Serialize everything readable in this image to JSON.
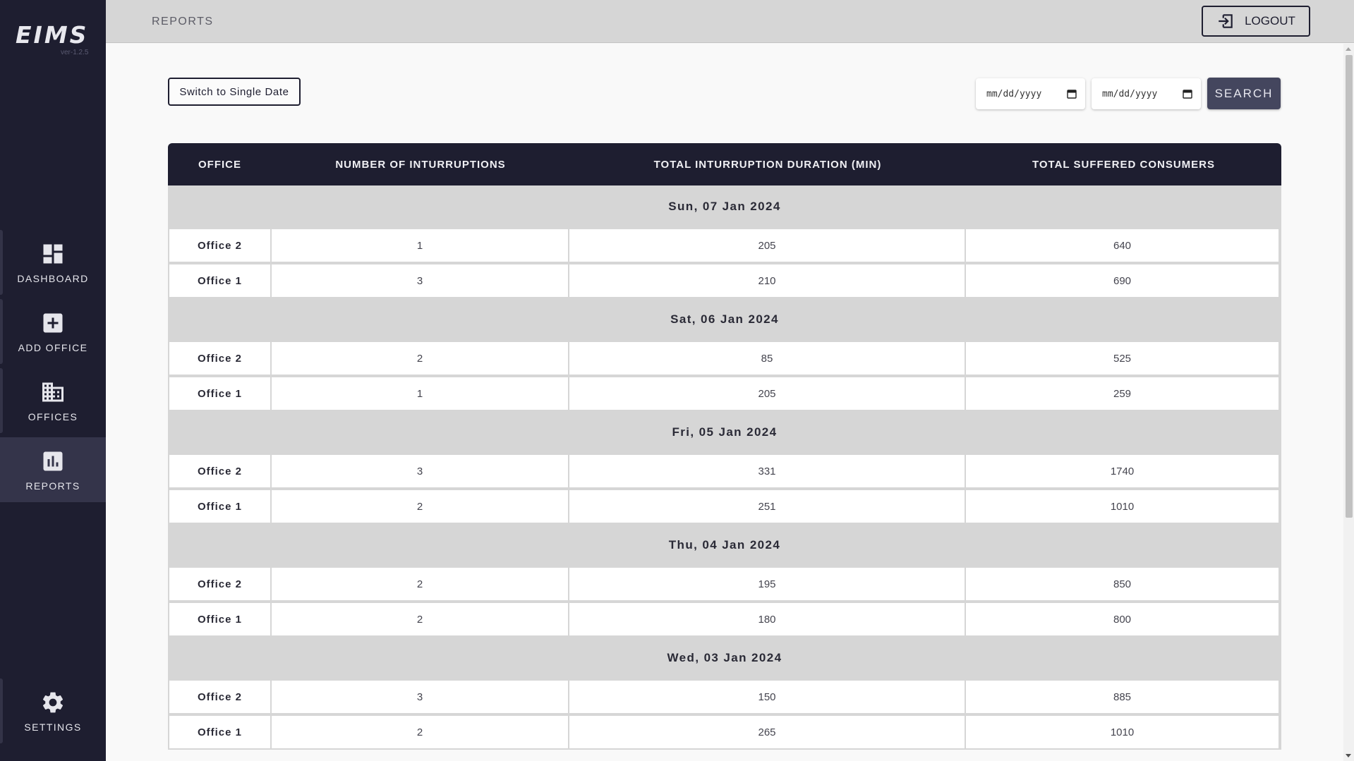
{
  "app": {
    "name": "EIMS",
    "version": "ver-1.2.5"
  },
  "sidebar": {
    "items": [
      {
        "label": "DASHBOARD",
        "icon": "dashboard-icon"
      },
      {
        "label": "ADD OFFICE",
        "icon": "add-box-icon"
      },
      {
        "label": "OFFICES",
        "icon": "building-icon"
      },
      {
        "label": "REPORTS",
        "icon": "bar-chart-icon",
        "active": true
      }
    ],
    "settings": {
      "label": "SETTINGS",
      "icon": "gear-icon"
    }
  },
  "header": {
    "title": "REPORTS",
    "logout_label": "LOGOUT"
  },
  "controls": {
    "switch_label": "Switch to Single Date",
    "start_date_placeholder": "mm/dd/yyyy",
    "end_date_placeholder": "mm/dd/yyyy",
    "search_label": "SEARCH"
  },
  "table": {
    "columns": [
      "OFFICE",
      "NUMBER OF INTURRUPTIONS",
      "TOTAL INTURRUPTION DURATION (MIN)",
      "TOTAL SUFFERED CONSUMERS"
    ],
    "groups": [
      {
        "date": "Sun, 07 Jan 2024",
        "rows": [
          {
            "office": "Office 2",
            "interruptions": "1",
            "duration": "205",
            "consumers": "640"
          },
          {
            "office": "Office 1",
            "interruptions": "3",
            "duration": "210",
            "consumers": "690"
          }
        ]
      },
      {
        "date": "Sat, 06 Jan 2024",
        "rows": [
          {
            "office": "Office 2",
            "interruptions": "2",
            "duration": "85",
            "consumers": "525"
          },
          {
            "office": "Office 1",
            "interruptions": "1",
            "duration": "205",
            "consumers": "259"
          }
        ]
      },
      {
        "date": "Fri, 05 Jan 2024",
        "rows": [
          {
            "office": "Office 2",
            "interruptions": "3",
            "duration": "331",
            "consumers": "1740"
          },
          {
            "office": "Office 1",
            "interruptions": "2",
            "duration": "251",
            "consumers": "1010"
          }
        ]
      },
      {
        "date": "Thu, 04 Jan 2024",
        "rows": [
          {
            "office": "Office 2",
            "interruptions": "2",
            "duration": "195",
            "consumers": "850"
          },
          {
            "office": "Office 1",
            "interruptions": "2",
            "duration": "180",
            "consumers": "800"
          }
        ]
      },
      {
        "date": "Wed, 03 Jan 2024",
        "rows": [
          {
            "office": "Office 2",
            "interruptions": "3",
            "duration": "150",
            "consumers": "885"
          },
          {
            "office": "Office 1",
            "interruptions": "2",
            "duration": "265",
            "consumers": "1010"
          }
        ]
      }
    ]
  }
}
